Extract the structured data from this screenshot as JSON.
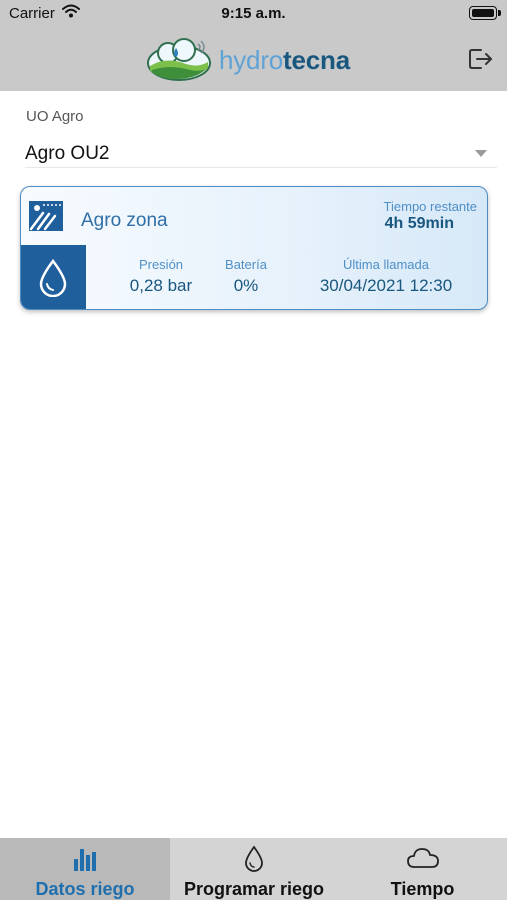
{
  "status_bar": {
    "carrier": "Carrier",
    "time": "9:15 a.m."
  },
  "header": {
    "brand_light": "hydro",
    "brand_dark": "tecna",
    "logout_icon": "logout-icon"
  },
  "uo": {
    "label": "UO Agro",
    "selected": "Agro OU2"
  },
  "card": {
    "zone_name": "Agro zona",
    "remaining_label": "Tiempo restante",
    "remaining_value": "4h 59min",
    "stats": [
      {
        "label": "Presión",
        "value": "0,28 bar"
      },
      {
        "label": "Batería",
        "value": "0%"
      },
      {
        "label": "Última llamada",
        "value": "30/04/2021 12:30"
      }
    ]
  },
  "tabs": [
    {
      "label": "Datos riego",
      "icon": "bar-chart-icon",
      "active": true
    },
    {
      "label": "Programar riego",
      "icon": "drop-icon",
      "active": false
    },
    {
      "label": "Tiempo",
      "icon": "cloud-icon",
      "active": false
    }
  ],
  "colors": {
    "accent": "#1f6fae",
    "card_border": "#4d8cc4",
    "drop_block": "#1e5f9c",
    "header_bg": "#c9c9c9"
  }
}
